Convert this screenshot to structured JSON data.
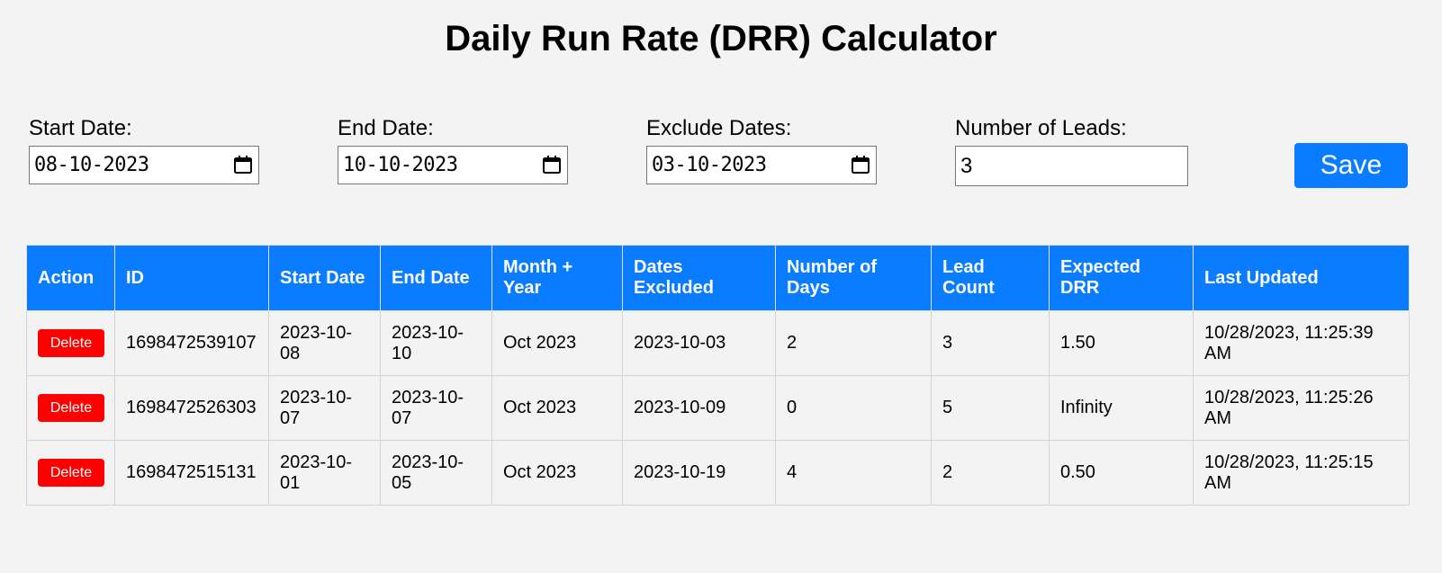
{
  "page": {
    "title": "Daily Run Rate (DRR) Calculator"
  },
  "form": {
    "start_date": {
      "label": "Start Date:",
      "value": "08-10-2023"
    },
    "end_date": {
      "label": "End Date:",
      "value": "10-10-2023"
    },
    "exclude_dates": {
      "label": "Exclude Dates:",
      "value": "03-10-2023"
    },
    "leads": {
      "label": "Number of Leads:",
      "value": "3"
    },
    "save_label": "Save",
    "calendar_icon": "calendar-icon"
  },
  "table": {
    "headers": [
      "Action",
      "ID",
      "Start Date",
      "End Date",
      "Month + Year",
      "Dates Excluded",
      "Number of Days",
      "Lead Count",
      "Expected DRR",
      "Last Updated"
    ],
    "delete_label": "Delete",
    "rows": [
      {
        "id": "1698472539107",
        "start_date": "2023-10-08",
        "end_date": "2023-10-10",
        "month_year": "Oct 2023",
        "dates_excluded": "2023-10-03",
        "num_days": "2",
        "lead_count": "3",
        "expected_drr": "1.50",
        "last_updated": "10/28/2023, 11:25:39 AM"
      },
      {
        "id": "1698472526303",
        "start_date": "2023-10-07",
        "end_date": "2023-10-07",
        "month_year": "Oct 2023",
        "dates_excluded": "2023-10-09",
        "num_days": "0",
        "lead_count": "5",
        "expected_drr": "Infinity",
        "last_updated": "10/28/2023, 11:25:26 AM"
      },
      {
        "id": "1698472515131",
        "start_date": "2023-10-01",
        "end_date": "2023-10-05",
        "month_year": "Oct 2023",
        "dates_excluded": "2023-10-19",
        "num_days": "4",
        "lead_count": "2",
        "expected_drr": "0.50",
        "last_updated": "10/28/2023, 11:25:15 AM"
      }
    ]
  },
  "colors": {
    "background": "#f3f3f3",
    "accent": "#0a7cff",
    "danger": "#ff0000"
  }
}
